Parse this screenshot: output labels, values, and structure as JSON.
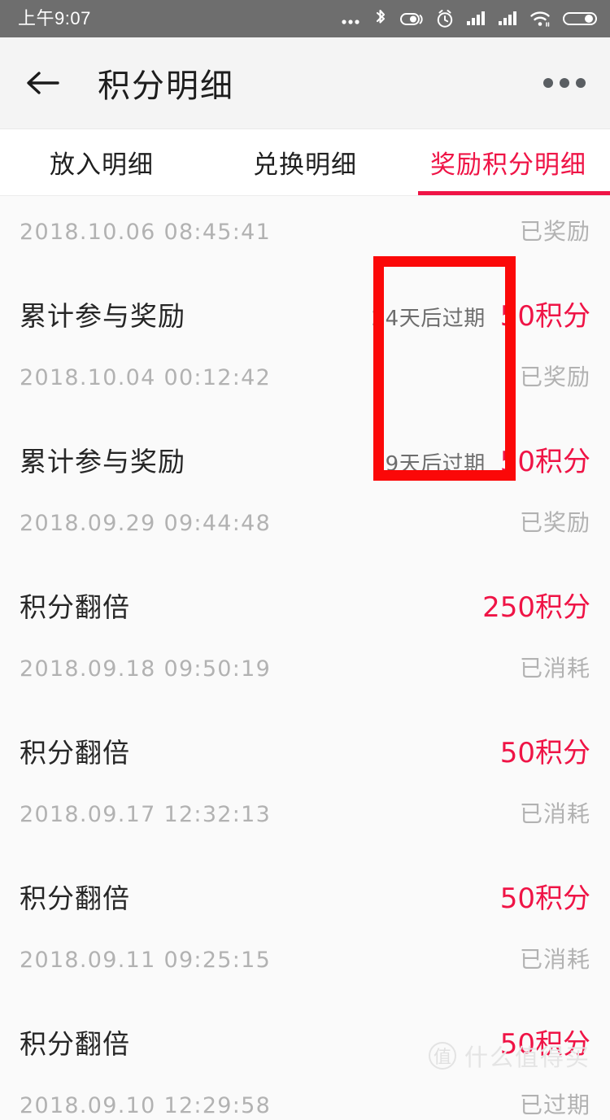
{
  "status_bar": {
    "time": "上午9:07",
    "icons": [
      "more-dots-icon",
      "bluetooth-icon",
      "do-not-disturb-icon",
      "alarm-icon",
      "signal-sim1-icon",
      "signal-sim2-icon",
      "wifi-icon",
      "battery-icon"
    ]
  },
  "header": {
    "back_icon": "back-arrow-icon",
    "title": "积分明细",
    "menu_icon": "more-options-icon"
  },
  "tabs": [
    {
      "label": "放入明细",
      "active": false
    },
    {
      "label": "兑换明细",
      "active": false
    },
    {
      "label": "奖励积分明细",
      "active": true
    }
  ],
  "colors": {
    "accent_red": "#ef1446",
    "annotation_red": "#fb0808",
    "status_bar_gray": "#6e6e6e",
    "muted_text": "#b2b2b2",
    "page_bg": "#fafafa"
  },
  "list": [
    {
      "clipped": true,
      "title": "",
      "expire": "",
      "points": "",
      "date": "2018.10.06 08:45:41",
      "status": "已奖励"
    },
    {
      "clipped": false,
      "title": "累计参与奖励",
      "expire": "24天后过期",
      "points": "50积分",
      "date": "2018.10.04 00:12:42",
      "status": "已奖励"
    },
    {
      "clipped": false,
      "title": "累计参与奖励",
      "expire": "19天后过期",
      "points": "50积分",
      "date": "2018.09.29 09:44:48",
      "status": "已奖励"
    },
    {
      "clipped": false,
      "title": "积分翻倍",
      "expire": "",
      "points": "250积分",
      "date": "2018.09.18 09:50:19",
      "status": "已消耗"
    },
    {
      "clipped": false,
      "title": "积分翻倍",
      "expire": "",
      "points": "50积分",
      "date": "2018.09.17 12:32:13",
      "status": "已消耗"
    },
    {
      "clipped": false,
      "title": "积分翻倍",
      "expire": "",
      "points": "50积分",
      "date": "2018.09.11 09:25:15",
      "status": "已消耗"
    },
    {
      "clipped": false,
      "title": "积分翻倍",
      "expire": "",
      "points": "50积分",
      "date": "2018.09.10 12:29:58",
      "status": "已过期"
    }
  ],
  "annotation": {
    "shape": "rectangle",
    "color": "#fb0808"
  },
  "watermark": {
    "badge": "值",
    "text": "什么值得买"
  }
}
